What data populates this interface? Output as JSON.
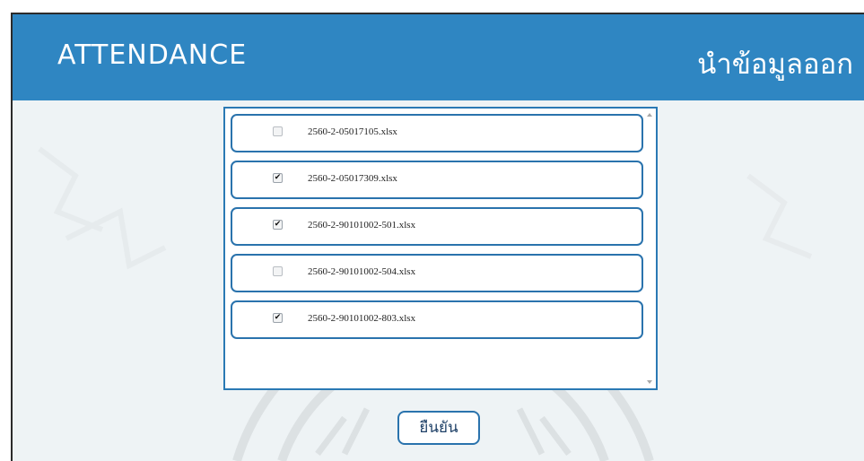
{
  "header": {
    "app_title": "ATTENDANCE",
    "action_label": "นำข้อมูลออก"
  },
  "files": [
    {
      "name": "2560-2-05017105.xlsx",
      "checked": false
    },
    {
      "name": "2560-2-05017309.xlsx",
      "checked": true
    },
    {
      "name": "2560-2-90101002-501.xlsx",
      "checked": true
    },
    {
      "name": "2560-2-90101002-504.xlsx",
      "checked": false
    },
    {
      "name": "2560-2-90101002-803.xlsx",
      "checked": true
    }
  ],
  "confirm_button": {
    "label": "ยืนยัน"
  },
  "colors": {
    "header_bg": "#2f86c2",
    "accent_border": "#2a73ad",
    "page_bg": "#eef3f5"
  }
}
